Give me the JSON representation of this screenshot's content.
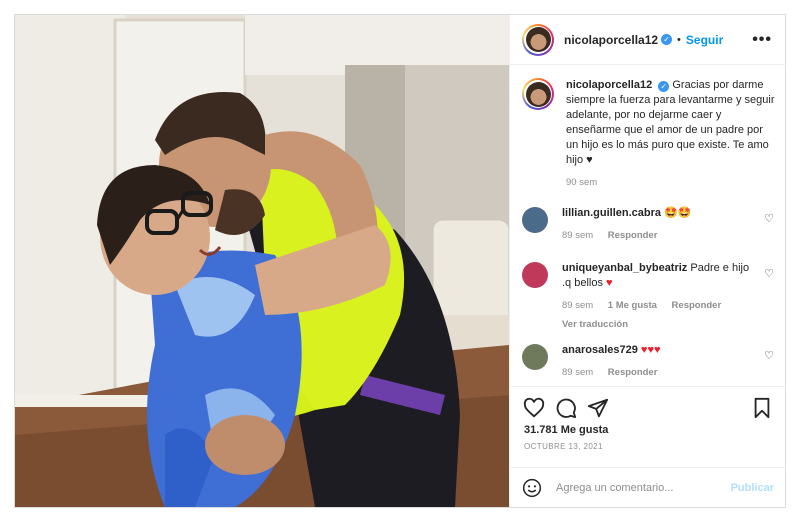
{
  "post": {
    "username": "nicolaporcella12",
    "verified_mark": "✓",
    "separator": "•",
    "follow_label": "Seguir",
    "more_label": "•••",
    "photo_alt": "photo"
  },
  "caption": {
    "username": "nicolaporcella12",
    "text": "Gracias por darme siempre la fuerza para levantarme y seguir adelante, por no dejarme caer y enseñarme que el amor de un padre por un hijo es lo más puro que existe. Te amo hijo ♥",
    "time": "90 sem"
  },
  "comments": [
    {
      "username": "lillian.guillen.cabra",
      "text": "🤩🤩",
      "time": "89 sem",
      "reply_label": "Responder",
      "avatar_color": "#4a6b8a"
    },
    {
      "username": "uniqueyanbal_bybeatriz",
      "text": "Padre e hijo .q bellos",
      "heart": "♥",
      "time": "89 sem",
      "likes_label": "1 Me gusta",
      "reply_label": "Responder",
      "translate_label": "Ver traducción",
      "avatar_color": "#c0395a"
    },
    {
      "username": "anarosales729",
      "hearts": "♥♥♥",
      "time": "89 sem",
      "reply_label": "Responder",
      "avatar_color": "#6f7a5c"
    }
  ],
  "actions": {
    "likes": "31.781 Me gusta",
    "date": "OCTUBRE 13, 2021"
  },
  "comment_box": {
    "placeholder": "Agrega un comentario...",
    "publish_label": "Publicar"
  },
  "colors": {
    "link_blue": "#0095f6",
    "publish_disabled": "#b2dffc",
    "muted_text": "#8e8e8e",
    "border": "#dbdbdb"
  }
}
